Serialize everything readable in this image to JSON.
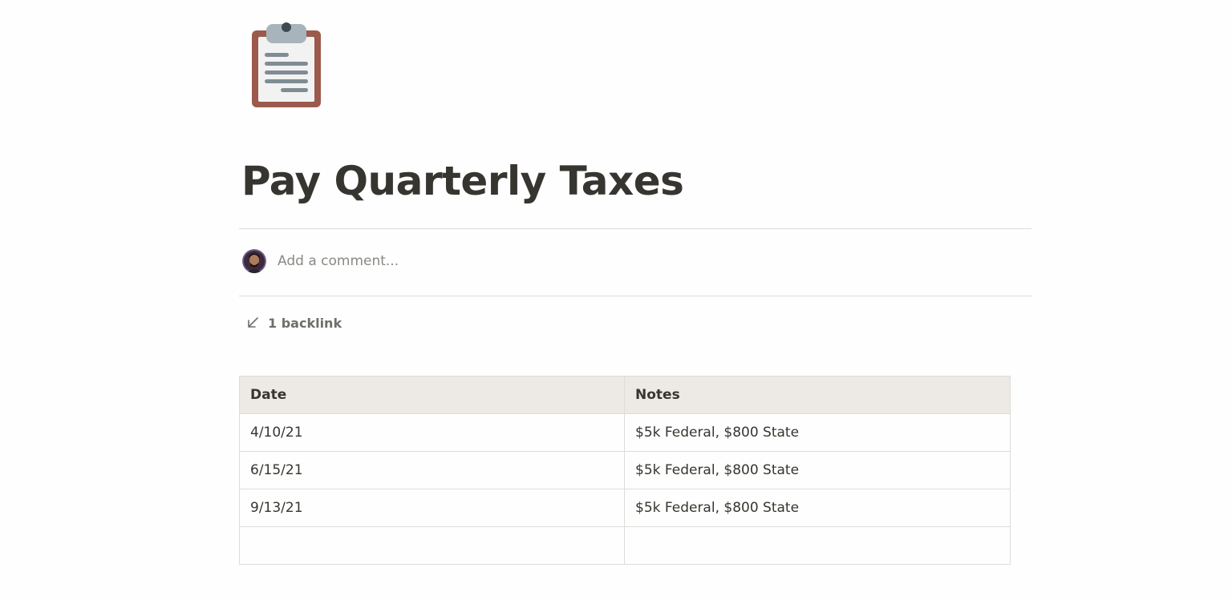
{
  "page": {
    "icon": "clipboard-icon",
    "title": "Pay Quarterly Taxes"
  },
  "comment": {
    "placeholder": "Add a comment...",
    "avatar": "user-avatar"
  },
  "backlinks": {
    "icon": "arrow-down-left-icon",
    "label": "1 backlink"
  },
  "table": {
    "columns": [
      "Date",
      "Notes"
    ],
    "rows": [
      [
        "4/10/21",
        "$5k Federal, $800 State"
      ],
      [
        "6/15/21",
        "$5k Federal, $800 State"
      ],
      [
        "9/13/21",
        "$5k Federal, $800 State"
      ],
      [
        "",
        ""
      ]
    ],
    "header_bg": "#ede9e4"
  },
  "colors": {
    "text": "#37352f",
    "muted": "#8a8984",
    "icon_brown": "#9b5a4c",
    "icon_gray": "#8796a0"
  }
}
